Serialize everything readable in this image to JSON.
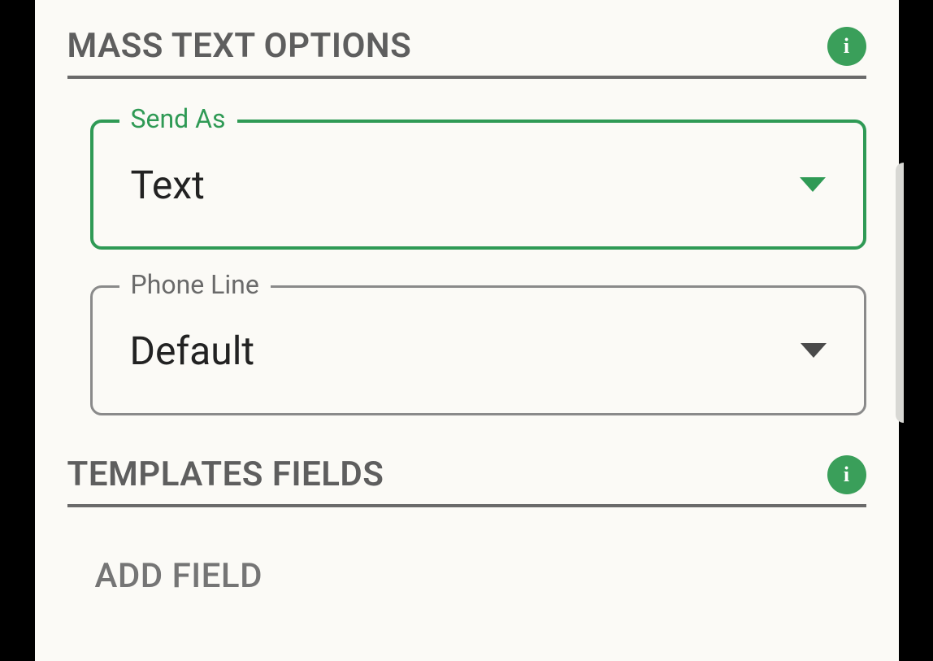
{
  "sections": {
    "massText": {
      "title": "MASS TEXT OPTIONS",
      "fields": {
        "sendAs": {
          "label": "Send As",
          "value": "Text"
        },
        "phoneLine": {
          "label": "Phone Line",
          "value": "Default"
        }
      }
    },
    "templates": {
      "title": "TEMPLATES FIELDS",
      "addField": "ADD FIELD"
    }
  },
  "icons": {
    "info": "i"
  }
}
